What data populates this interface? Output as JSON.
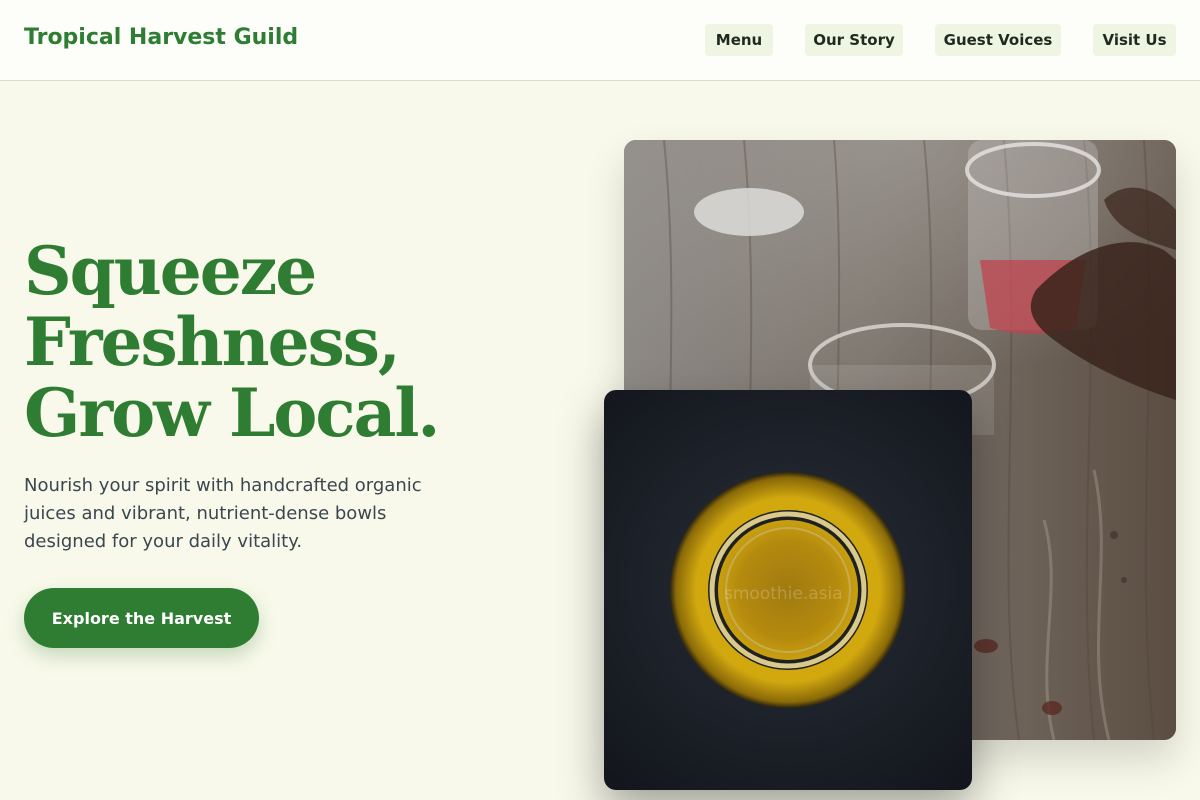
{
  "brand": {
    "name": "Tropical Harvest Guild"
  },
  "nav": {
    "items": [
      {
        "label": "Menu"
      },
      {
        "label": "Our Story"
      },
      {
        "label": "Guest Voices"
      },
      {
        "label": "Visit Us"
      }
    ]
  },
  "hero": {
    "headline_lines": [
      "Squeeze",
      "Freshness,",
      "Grow Local."
    ],
    "subtitle": "Nourish your spirit with handcrafted organic juices and vibrant, nutrient-dense bowls designed for your daily vitality.",
    "cta_label": "Explore the Harvest"
  },
  "images": {
    "front_watermark": "smoothie.asia"
  },
  "colors": {
    "brand_green": "#2e7d32",
    "page_background": "#f8f9ea",
    "nav_pill": "#eef5e3",
    "body_text": "#3a4650"
  }
}
